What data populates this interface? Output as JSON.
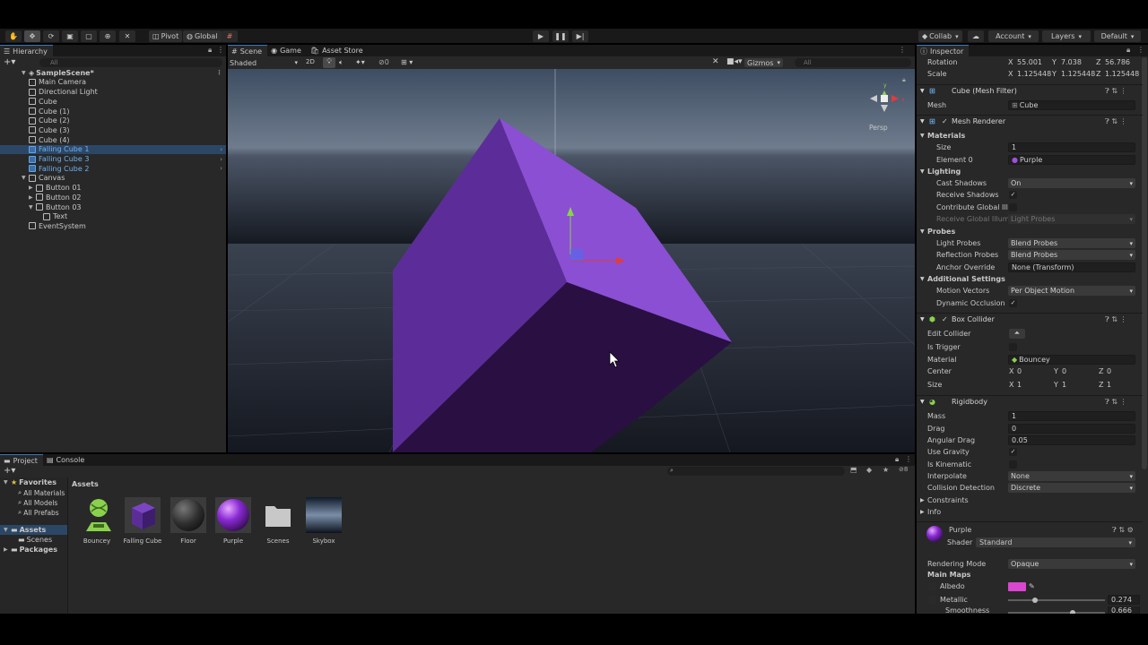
{
  "toolbar": {
    "pivot": "Pivot",
    "global": "Global",
    "collab": "Collab",
    "account": "Account",
    "layers": "Layers",
    "layout": "Default"
  },
  "hierarchy": {
    "tab": "Hierarchy",
    "search_placeholder": "All",
    "items": [
      {
        "label": "SampleScene*",
        "indent": 0,
        "kind": "scene"
      },
      {
        "label": "Main Camera",
        "indent": 1,
        "kind": "obj"
      },
      {
        "label": "Directional Light",
        "indent": 1,
        "kind": "obj"
      },
      {
        "label": "Cube",
        "indent": 1,
        "kind": "obj"
      },
      {
        "label": "Cube (1)",
        "indent": 1,
        "kind": "obj"
      },
      {
        "label": "Cube (2)",
        "indent": 1,
        "kind": "obj"
      },
      {
        "label": "Cube (3)",
        "indent": 1,
        "kind": "obj"
      },
      {
        "label": "Cube (4)",
        "indent": 1,
        "kind": "obj"
      },
      {
        "label": "Falling Cube 1",
        "indent": 1,
        "kind": "prefab",
        "selected": true
      },
      {
        "label": "Falling Cube 3",
        "indent": 1,
        "kind": "prefab"
      },
      {
        "label": "Falling Cube 2",
        "indent": 1,
        "kind": "prefab"
      },
      {
        "label": "Canvas",
        "indent": 1,
        "kind": "obj"
      },
      {
        "label": "Button 01",
        "indent": 2,
        "kind": "obj"
      },
      {
        "label": "Button 02",
        "indent": 2,
        "kind": "obj"
      },
      {
        "label": "Button 03",
        "indent": 2,
        "kind": "obj"
      },
      {
        "label": "Text",
        "indent": 3,
        "kind": "obj"
      },
      {
        "label": "EventSystem",
        "indent": 1,
        "kind": "obj"
      }
    ]
  },
  "scene": {
    "tabs": [
      "Scene",
      "Game",
      "Asset Store"
    ],
    "shading": "Shaded",
    "mode2d": "2D",
    "fx_count": "0",
    "gizmos": "Gizmos",
    "search_placeholder": "All",
    "persp": "Persp"
  },
  "project": {
    "tabs": [
      "Project",
      "Console"
    ],
    "favorites": "Favorites",
    "fav_items": [
      "All Materials",
      "All Models",
      "All Prefabs"
    ],
    "assets_root": "Assets",
    "assets_children": [
      "Scenes"
    ],
    "packages": "Packages",
    "breadcrumb": "Assets",
    "badge": "8",
    "assets": [
      {
        "label": "Bouncey",
        "icon": "physics-material-icon"
      },
      {
        "label": "Falling Cube",
        "icon": "prefab-icon"
      },
      {
        "label": "Floor",
        "icon": "material-icon"
      },
      {
        "label": "Purple",
        "icon": "material-icon"
      },
      {
        "label": "Scenes",
        "icon": "folder-icon"
      },
      {
        "label": "Skybox",
        "icon": "skybox-icon"
      }
    ]
  },
  "inspector": {
    "tab": "Inspector",
    "rotation": {
      "label": "Rotation",
      "x": "55.001",
      "y": "7.038",
      "z": "56.786"
    },
    "scale": {
      "label": "Scale",
      "x": "1.125448",
      "y": "1.125448",
      "z": "1.125448"
    },
    "mesh_filter": {
      "title": "Cube (Mesh Filter)",
      "mesh_label": "Mesh",
      "mesh_value": "Cube"
    },
    "mesh_renderer": {
      "title": "Mesh Renderer",
      "materials": "Materials",
      "size_label": "Size",
      "size_value": "1",
      "element_label": "Element 0",
      "element_value": "Purple",
      "lighting": "Lighting",
      "cast_shadows_label": "Cast Shadows",
      "cast_shadows_value": "On",
      "receive_shadows_label": "Receive Shadows",
      "contribute_gi_label": "Contribute Global Illu",
      "receive_gi_label": "Receive Global Illumi",
      "receive_gi_value": "Light Probes",
      "probes": "Probes",
      "light_probes_label": "Light Probes",
      "light_probes_value": "Blend Probes",
      "reflection_probes_label": "Reflection Probes",
      "reflection_probes_value": "Blend Probes",
      "anchor_label": "Anchor Override",
      "anchor_value": "None (Transform)",
      "additional": "Additional Settings",
      "motion_vectors_label": "Motion Vectors",
      "motion_vectors_value": "Per Object Motion",
      "dynamic_occlusion_label": "Dynamic Occlusion"
    },
    "box_collider": {
      "title": "Box Collider",
      "edit_label": "Edit Collider",
      "is_trigger_label": "Is Trigger",
      "material_label": "Material",
      "material_value": "Bouncey",
      "center_label": "Center",
      "center": {
        "x": "0",
        "y": "0",
        "z": "0"
      },
      "size_label": "Size",
      "size": {
        "x": "1",
        "y": "1",
        "z": "1"
      }
    },
    "rigidbody": {
      "title": "Rigidbody",
      "mass_label": "Mass",
      "mass": "1",
      "drag_label": "Drag",
      "drag": "0",
      "angular_drag_label": "Angular Drag",
      "angular_drag": "0.05",
      "use_gravity_label": "Use Gravity",
      "is_kinematic_label": "Is Kinematic",
      "interpolate_label": "Interpolate",
      "interpolate": "None",
      "collision_label": "Collision Detection",
      "collision": "Discrete",
      "constraints": "Constraints",
      "info": "Info"
    },
    "material": {
      "title": "Purple",
      "shader_label": "Shader",
      "shader": "Standard",
      "rendering_mode_label": "Rendering Mode",
      "rendering_mode": "Opaque",
      "main_maps": "Main Maps",
      "albedo_label": "Albedo",
      "albedo_color": "#d946d0",
      "metallic_label": "Metallic",
      "metallic": "0.274",
      "smoothness_label": "Smoothness",
      "smoothness": "0.666"
    }
  }
}
